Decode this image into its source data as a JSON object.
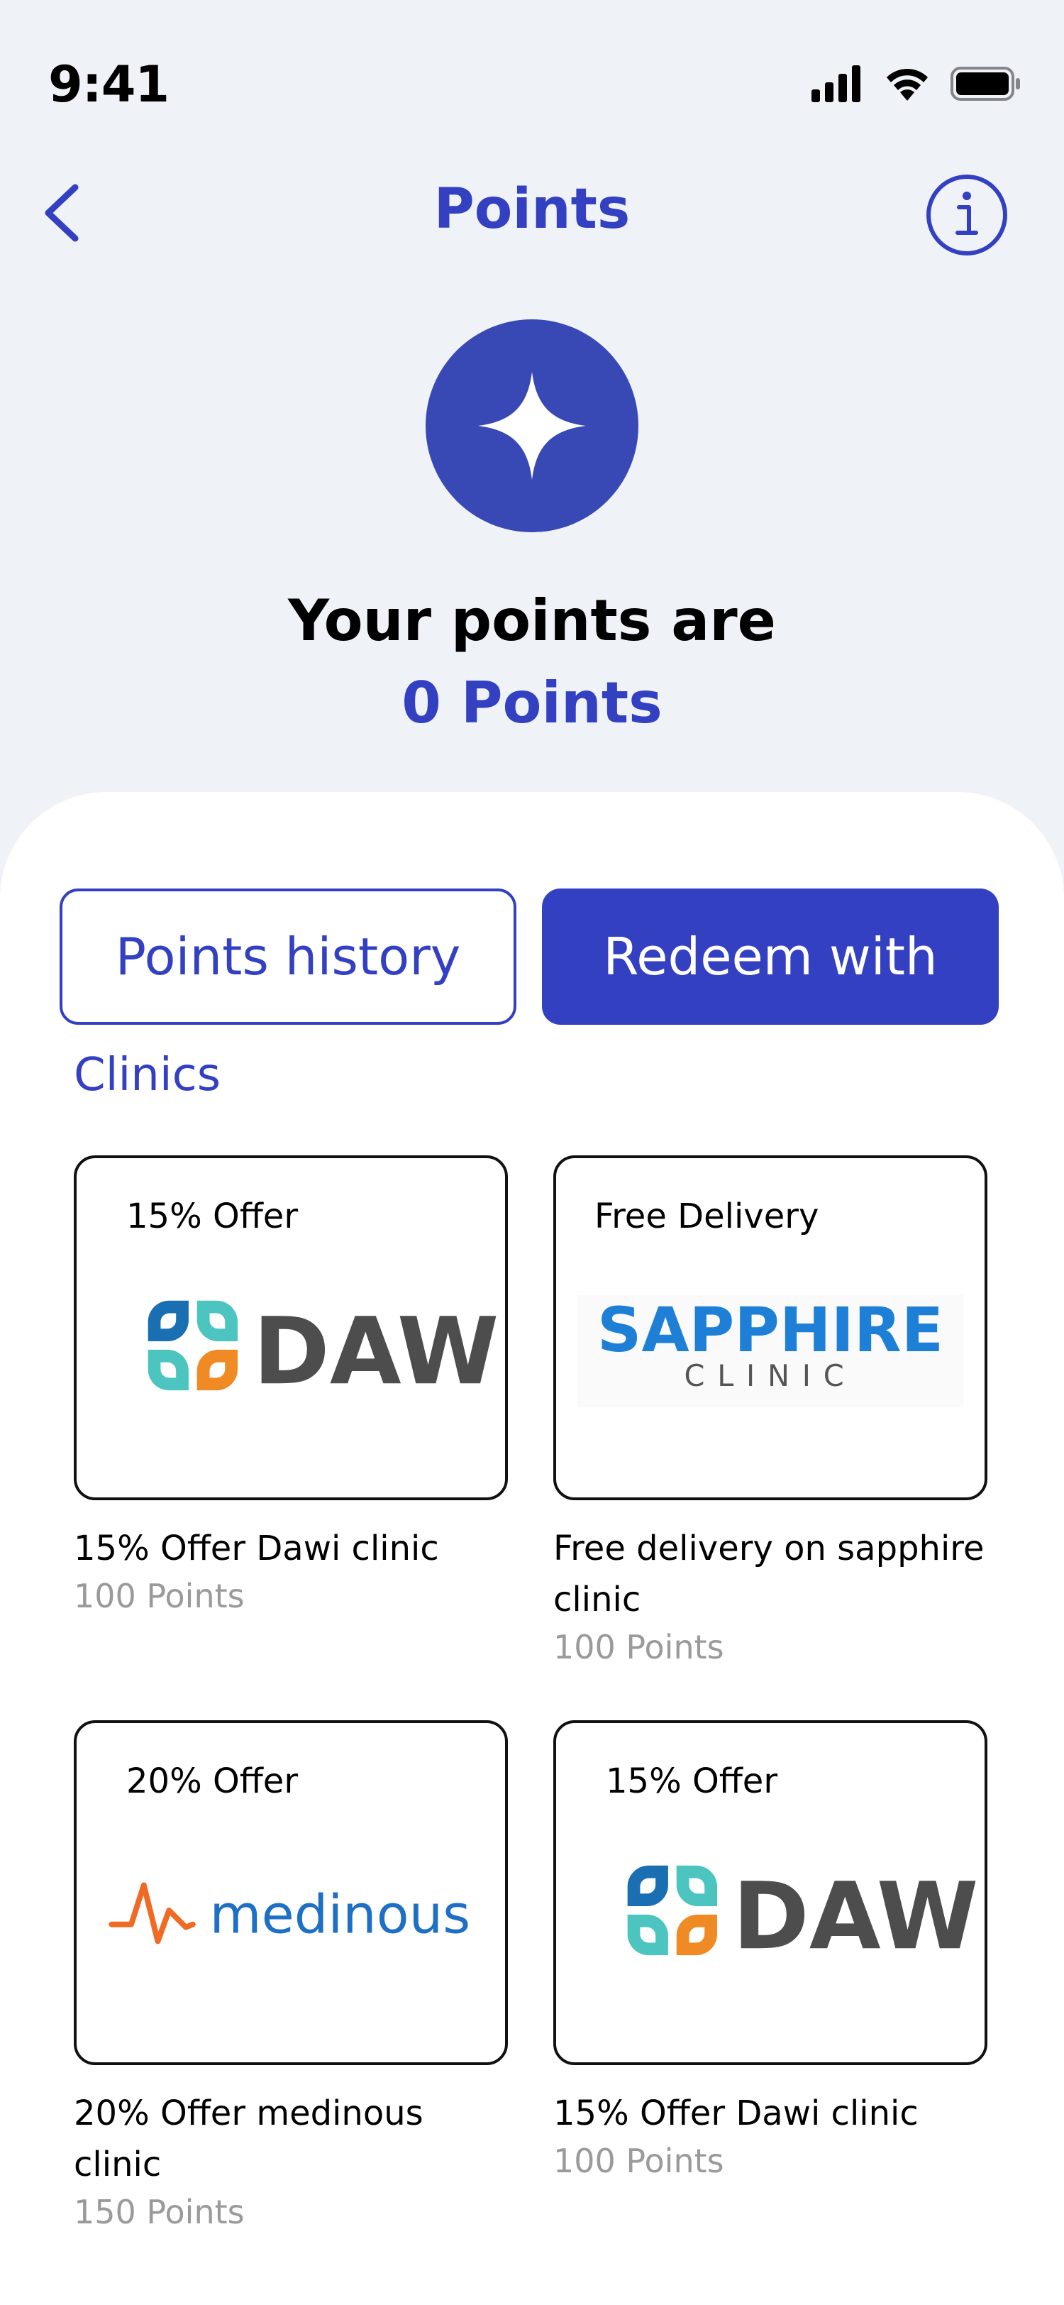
{
  "status_bar": {
    "time": "9:41"
  },
  "header": {
    "title": "Points"
  },
  "summary": {
    "headline": "Your points are",
    "points_value": "0",
    "points_unit": "Points"
  },
  "tabs": {
    "history_label": "Points history",
    "redeem_label": "Redeem with"
  },
  "section": {
    "title": "Clinics"
  },
  "offers": [
    {
      "tag": "15% Offer",
      "logo_text": "DAWI",
      "title": "15% Offer Dawi clinic",
      "points": "100 Points"
    },
    {
      "tag": "Free Delivery",
      "logo_text": "SAPPHIRE",
      "logo_subtext": "CLINIC",
      "title": "Free delivery on sapphire clinic",
      "points": "100 Points"
    },
    {
      "tag": "20% Offer",
      "logo_text": "medinous",
      "title": "20% Offer medinous clinic",
      "points": "150 Points"
    },
    {
      "tag": "15% Offer",
      "logo_text": "DAWI",
      "title": "15% Offer Dawi clinic",
      "points": "100 Points"
    }
  ],
  "colors": {
    "accent": "#3340c2",
    "badge": "#3849b5",
    "background": "#eff2f7",
    "muted_text": "#9a9a9a"
  },
  "icons": [
    "back-chevron-icon",
    "info-icon",
    "sparkle-star-icon",
    "signal-icon",
    "wifi-icon",
    "battery-icon"
  ]
}
